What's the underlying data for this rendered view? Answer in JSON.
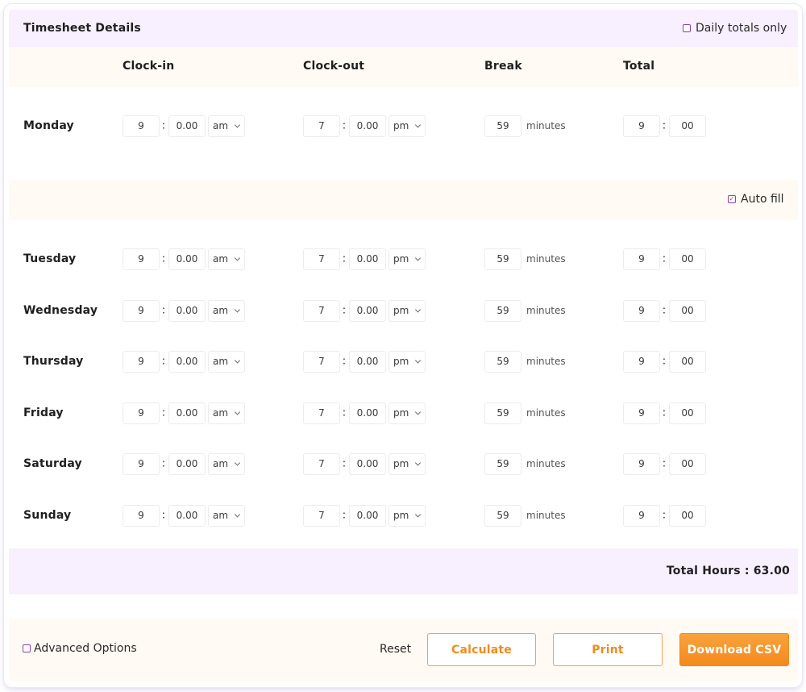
{
  "header": {
    "title": "Timesheet Details",
    "daily_totals_label": "Daily totals only",
    "daily_totals_checked": false
  },
  "columns": {
    "clock_in": "Clock-in",
    "clock_out": "Clock-out",
    "break": "Break",
    "total": "Total"
  },
  "auto_fill": {
    "label": "Auto fill",
    "checked": true
  },
  "rows": [
    {
      "day": "Monday",
      "in_h": "9",
      "in_m": "0.00",
      "in_ap": "am",
      "out_h": "7",
      "out_m": "0.00",
      "out_ap": "pm",
      "break": "59",
      "break_unit": "minutes",
      "tot_h": "9",
      "tot_m": "00"
    },
    {
      "day": "Tuesday",
      "in_h": "9",
      "in_m": "0.00",
      "in_ap": "am",
      "out_h": "7",
      "out_m": "0.00",
      "out_ap": "pm",
      "break": "59",
      "break_unit": "minutes",
      "tot_h": "9",
      "tot_m": "00"
    },
    {
      "day": "Wednesday",
      "in_h": "9",
      "in_m": "0.00",
      "in_ap": "am",
      "out_h": "7",
      "out_m": "0.00",
      "out_ap": "pm",
      "break": "59",
      "break_unit": "minutes",
      "tot_h": "9",
      "tot_m": "00"
    },
    {
      "day": "Thursday",
      "in_h": "9",
      "in_m": "0.00",
      "in_ap": "am",
      "out_h": "7",
      "out_m": "0.00",
      "out_ap": "pm",
      "break": "59",
      "break_unit": "minutes",
      "tot_h": "9",
      "tot_m": "00"
    },
    {
      "day": "Friday",
      "in_h": "9",
      "in_m": "0.00",
      "in_ap": "am",
      "out_h": "7",
      "out_m": "0.00",
      "out_ap": "pm",
      "break": "59",
      "break_unit": "minutes",
      "tot_h": "9",
      "tot_m": "00"
    },
    {
      "day": "Saturday",
      "in_h": "9",
      "in_m": "0.00",
      "in_ap": "am",
      "out_h": "7",
      "out_m": "0.00",
      "out_ap": "pm",
      "break": "59",
      "break_unit": "minutes",
      "tot_h": "9",
      "tot_m": "00"
    },
    {
      "day": "Sunday",
      "in_h": "9",
      "in_m": "0.00",
      "in_ap": "am",
      "out_h": "7",
      "out_m": "0.00",
      "out_ap": "pm",
      "break": "59",
      "break_unit": "minutes",
      "tot_h": "9",
      "tot_m": "00"
    }
  ],
  "separator": ":",
  "summary": {
    "total_hours_text": "Total Hours : 63.00"
  },
  "footer": {
    "advanced_label": "Advanced Options",
    "advanced_checked": false,
    "reset_label": "Reset",
    "calculate_label": "Calculate",
    "print_label": "Print",
    "download_label": "Download CSV"
  },
  "colors": {
    "accent": "#f28a1c",
    "check": "#8a3fb8",
    "panel_purple": "#f8efff",
    "panel_cream": "#fffaf3"
  }
}
